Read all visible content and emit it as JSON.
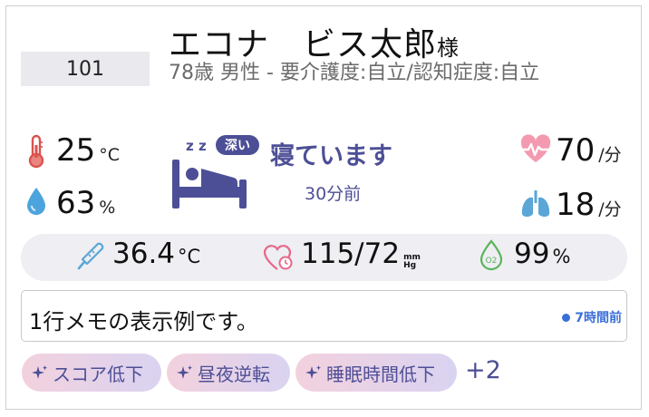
{
  "resident": {
    "room": "101",
    "name": "エコナ　ビス太郎",
    "honorific": "様",
    "info": "78歳 男性 - 要介護度:自立/認知症度:自立"
  },
  "environment": {
    "temperature_value": "25",
    "temperature_unit": "°C",
    "humidity_value": "63",
    "humidity_unit": "%"
  },
  "sleep": {
    "zz": "z z",
    "depth_badge": "深い",
    "status": "寝ています",
    "elapsed": "30分前"
  },
  "rates": {
    "heart_value": "70",
    "heart_unit": "/分",
    "resp_value": "18",
    "resp_unit": "/分"
  },
  "band": {
    "body_temp_value": "36.4",
    "body_temp_unit": "°C",
    "bp_value": "115/72",
    "bp_unit_top": "mm",
    "bp_unit_bottom": "Hg",
    "spo2_value": "99",
    "spo2_unit": "%",
    "spo2_icon_label": "O2"
  },
  "memo": {
    "text": "1行メモの表示例です。",
    "time": "7時間前"
  },
  "tags": [
    {
      "label": "スコア低下"
    },
    {
      "label": "昼夜逆転"
    },
    {
      "label": "睡眠時間低下"
    }
  ],
  "more_tags": "+2",
  "colors": {
    "accent": "#4d4f96",
    "heart": "#e8678a",
    "lungs": "#5aa6d6",
    "thermometer": "#d9534f",
    "drop": "#4da3dd",
    "spo2": "#5bb55b",
    "memo_time": "#3a6fd8"
  },
  "icons": [
    "thermometer-icon",
    "water-drop-icon",
    "sleeping-bed-icon",
    "heart-rate-icon",
    "lungs-icon",
    "body-thermometer-icon",
    "blood-pressure-heart-icon",
    "oxygen-drop-icon",
    "sparkle-icon"
  ]
}
